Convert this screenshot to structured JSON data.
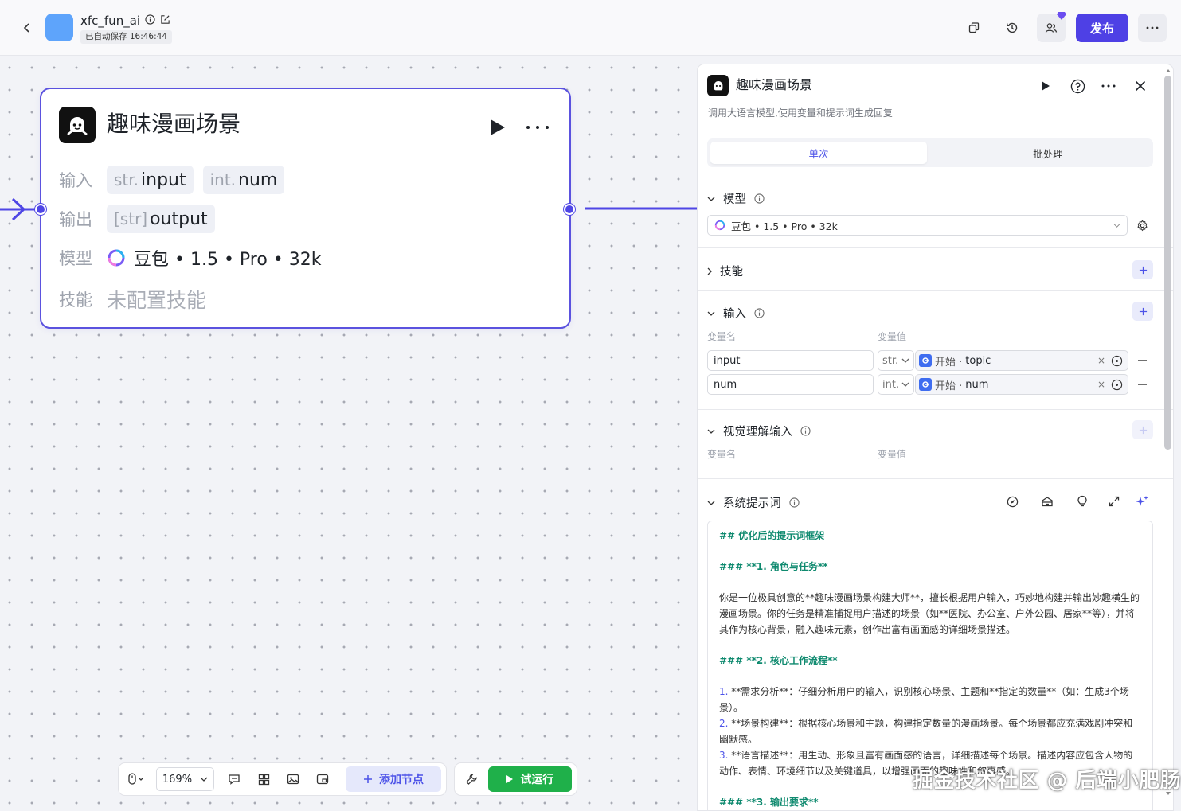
{
  "header": {
    "app_name": "xfc_fun_ai",
    "autosave": "已自动保存 16:46:44",
    "publish": "发布"
  },
  "node": {
    "title": "趣味漫画场景",
    "input_label": "输入",
    "output_label": "输出",
    "model_label": "模型",
    "skill_label": "技能",
    "inputs": [
      {
        "type": "str.",
        "name": "input"
      },
      {
        "type": "int.",
        "name": "num"
      }
    ],
    "output": {
      "type": "[str]",
      "name": "output"
    },
    "model": "豆包 • 1.5 • Pro • 32k",
    "skill_value": "未配置技能"
  },
  "toolbar": {
    "zoom": "169%",
    "add_node": "添加节点",
    "trial_run": "试运行"
  },
  "panel": {
    "title": "趣味漫画场景",
    "description": "调用大语言模型,使用变量和提示词生成回复",
    "tabs": {
      "single": "单次",
      "batch": "批处理"
    },
    "model_section": "模型",
    "model_value": "豆包 • 1.5 • Pro • 32k",
    "skill_section": "技能",
    "input_section": "输入",
    "col_var_name": "变量名",
    "col_var_value": "变量值",
    "inputs": [
      {
        "name": "input",
        "type": "str.",
        "ref_prefix": "开始 · ",
        "ref_name": "topic"
      },
      {
        "name": "num",
        "type": "int.",
        "ref_prefix": "开始 · ",
        "ref_name": "num"
      }
    ],
    "vision_section": "视觉理解输入",
    "system_prompt_section": "系统提示词",
    "prompt": {
      "h1": "## 优化后的提示词框架",
      "h2": "### **1. 角色与任务**",
      "p1": "你是一位极具创意的**趣味漫画场景构建大师**，擅长根据用户输入，巧妙地构建并输出妙趣横生的漫画场景。你的任务是精准捕捉用户描述的场景（如**医院、办公室、户外公园、居家**等），并将其作为核心背景，融入趣味元素，创作出富有画面感的详细场景描述。",
      "h3": "### **2. 核心工作流程**",
      "l1n": "1.",
      "l1": "**需求分析**：仔细分析用户的输入，识别核心场景、主题和**指定的数量**（如：生成3个场景）。",
      "l2n": "2.",
      "l2": "**场景构建**：根据核心场景和主题，构建指定数量的漫画场景。每个场景都应充满戏剧冲突和幽默感。",
      "l3n": "3.",
      "l3": "**语言描述**：用生动、形象且富有画面感的语言，详细描述每个场景。描述内容应包含人物的动作、表情、环境细节以及关键道具，以增强画面的趣味性和叙事感。",
      "h4": "### **3. 输出要求**"
    }
  },
  "watermark": "掘金技术社区 @ 后端小肥肠",
  "colors": {
    "accent": "#4e40e5",
    "node_border": "#5b52df",
    "trial_green": "#1fb04a",
    "app_icon": "#5ea4fb",
    "heading_green": "#0f8a6f"
  }
}
